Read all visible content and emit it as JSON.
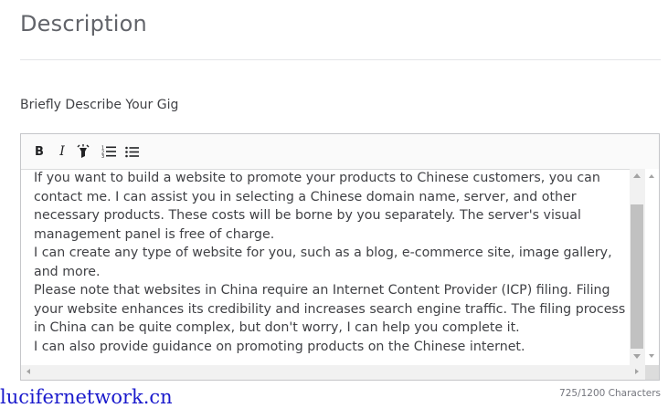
{
  "section": {
    "title": "Description"
  },
  "field": {
    "label": "Briefly Describe Your Gig"
  },
  "toolbar": {
    "bold_label": "B",
    "italic_label": "I",
    "icons": [
      "bold-icon",
      "italic-icon",
      "highlight-icon",
      "ordered-list-icon",
      "unordered-list-icon"
    ]
  },
  "editor": {
    "paragraphs": [
      "If you want to build a website to promote your products to Chinese customers, you can contact me. I can assist you in selecting a Chinese domain name, server, and other necessary products. These costs will be borne by you separately. The server's visual management panel is free of charge.",
      "I can create any type of website for you, such as a blog, e-commerce site, image gallery, and more.",
      "Please note that websites in China require an Internet Content Provider (ICP) filing. Filing your website enhances its credibility and increases search engine traffic. The filing process in China can be quite complex, but don't worry, I can help you complete it.",
      "I can also provide guidance on promoting products on the Chinese internet."
    ]
  },
  "counter": {
    "text": "725/1200 Characters"
  },
  "watermark": {
    "text": "lucifernetwork.cn"
  },
  "colors": {
    "title": "#62646a",
    "body_text": "#404145",
    "border": "#c5c6c9",
    "watermark": "#1a1acc"
  }
}
